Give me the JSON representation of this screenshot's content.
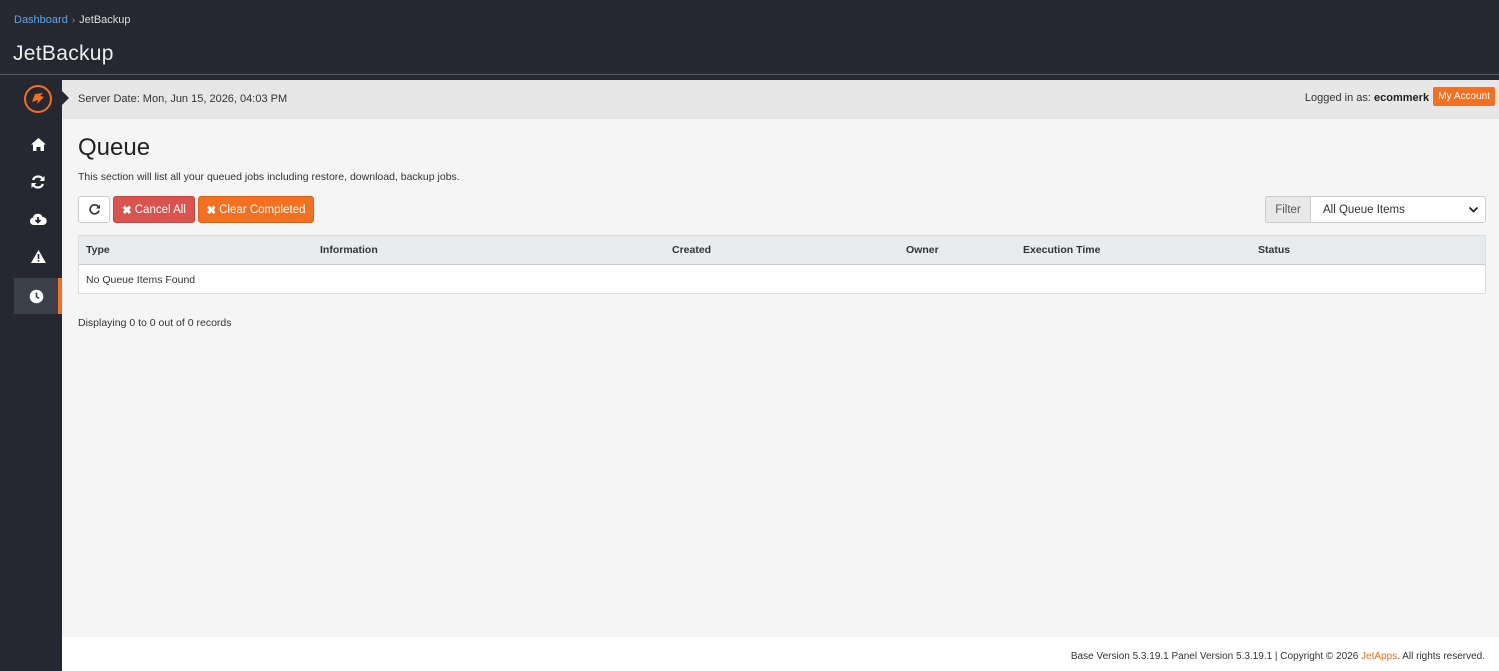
{
  "breadcrumb": {
    "home": "Dashboard",
    "separator": "›",
    "current": "JetBackup"
  },
  "app_title": "JetBackup",
  "sidebar": {
    "items": [
      {
        "icon": "home-icon"
      },
      {
        "icon": "sync-icon"
      },
      {
        "icon": "cloud-download-icon"
      },
      {
        "icon": "warning-icon"
      },
      {
        "icon": "clock-icon",
        "active": true
      }
    ]
  },
  "header": {
    "server_date": "Server Date: Mon, Jun 15, 2026, 04:03 PM",
    "logged_in_prefix": "Logged in as:",
    "username": "ecommerk",
    "separator": "|",
    "my_account": "My Account"
  },
  "page": {
    "title": "Queue",
    "description": "This section will list all your queued jobs including restore, download, backup jobs."
  },
  "toolbar": {
    "cancel_all": "Cancel All",
    "clear_completed": "Clear Completed",
    "filter_label": "Filter",
    "filter_value": "All Queue Items"
  },
  "table": {
    "columns": [
      "Type",
      "Information",
      "Created",
      "Owner",
      "Execution Time",
      "Status"
    ],
    "empty_message": "No Queue Items Found"
  },
  "records": "Displaying 0 to 0 out of 0 records",
  "footer": {
    "text_before": "Base Version 5.3.19.1 Panel Version 5.3.19.1 | Copyright © 2026 ",
    "link": "JetApps",
    "text_after": ". All rights reserved."
  },
  "colors": {
    "accent": "#f37021",
    "danger": "#d9534f",
    "dark": "#252830"
  }
}
